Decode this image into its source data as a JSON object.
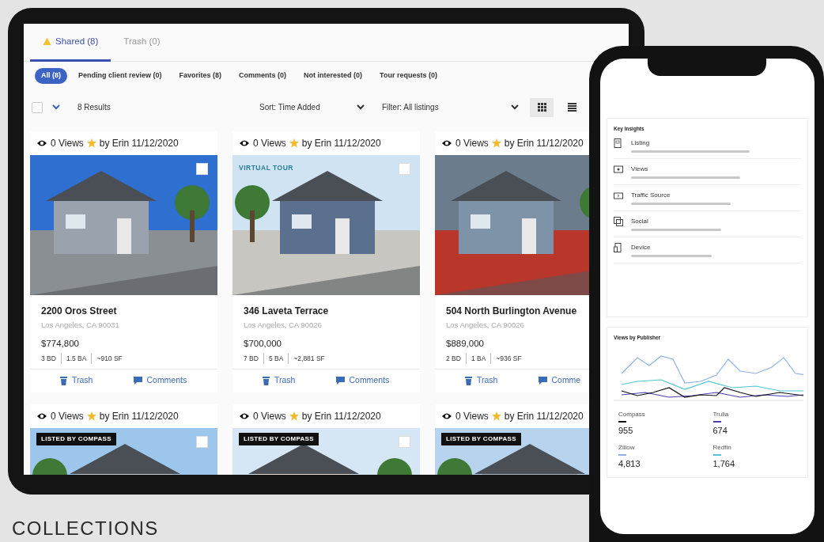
{
  "tabs": [
    {
      "label": "Shared (8)",
      "selected": true,
      "warning": true
    },
    {
      "label": "Trash (0)",
      "selected": false,
      "warning": false
    }
  ],
  "filters": [
    {
      "label": "All (8)",
      "selected": true
    },
    {
      "label": "Pending client review (0)",
      "selected": false
    },
    {
      "label": "Favorites (8)",
      "selected": false
    },
    {
      "label": "Comments (0)",
      "selected": false
    },
    {
      "label": "Not interested (0)",
      "selected": false
    },
    {
      "label": "Tour requests (0)",
      "selected": false
    }
  ],
  "toolbar": {
    "select_all": {
      "checked": false
    },
    "results": "8 Results",
    "sort": "Sort: Time Added",
    "filter": "Filter: All listings",
    "view_modes": [
      {
        "kind": "grid",
        "selected": true
      },
      {
        "kind": "list",
        "selected": false
      }
    ]
  },
  "listings": [
    {
      "views": "0 Views",
      "shared_by": "by Erin 11/12/2020",
      "selected": false,
      "title": "2200 Oros Street",
      "address": "Los Angeles, CA 90031",
      "price": "$774,800",
      "specs": [
        "3 BD",
        "1.5 BA",
        "~910 SF"
      ],
      "actions": [
        "Trash",
        "Comments"
      ]
    },
    {
      "views": "0 Views",
      "shared_by": "by Erin 11/12/2020",
      "badge": "VIRTUAL TOUR",
      "selected": false,
      "title": "346 Laveta Terrace",
      "address": "Los Angeles, CA 90026",
      "price": "$700,000",
      "specs": [
        "7 BD",
        "5 BA",
        "~2,881 SF"
      ],
      "actions": [
        "Trash",
        "Comments"
      ]
    },
    {
      "views": "0 Views",
      "shared_by": "by Erin 11/12/2020",
      "title": "504 North Burlington Avenue",
      "address": "Los Angeles, CA 90026",
      "price": "$889,000",
      "specs": [
        "2 BD",
        "1 BA",
        "~936 SF"
      ],
      "actions": [
        "Trash",
        "Comme"
      ]
    },
    {
      "views": "0 Views",
      "shared_by": "by Erin 11/12/2020",
      "badge": "LISTED BY COMPASS",
      "selected": false
    },
    {
      "views": "0 Views",
      "shared_by": "by Erin 11/12/2020",
      "badge": "LISTED BY COMPASS",
      "selected": false
    },
    {
      "views": "0 Views",
      "shared_by": "by Erin 11/12/2020",
      "badge": "LISTED BY COMPASS"
    }
  ],
  "key_insights": {
    "title": "Key Insights",
    "items": [
      {
        "kind": "listing",
        "label": "Listing"
      },
      {
        "kind": "views",
        "label": "Views"
      },
      {
        "kind": "traffic",
        "label": "Traffic Source"
      },
      {
        "kind": "social",
        "label": "Social"
      },
      {
        "kind": "device",
        "label": "Device"
      }
    ]
  },
  "publisher_views": {
    "title": "Views by Publisher",
    "legend": [
      {
        "name": "Compass",
        "color": "#111111",
        "value": "955"
      },
      {
        "name": "Trulia",
        "color": "#4a3fb0",
        "value": "674"
      },
      {
        "name": "Zillow",
        "color": "#8fb2e6",
        "value": "4,813"
      },
      {
        "name": "Redfin",
        "color": "#4fc6d3",
        "value": "1,764"
      }
    ]
  },
  "caption": "COLLECTIONS"
}
